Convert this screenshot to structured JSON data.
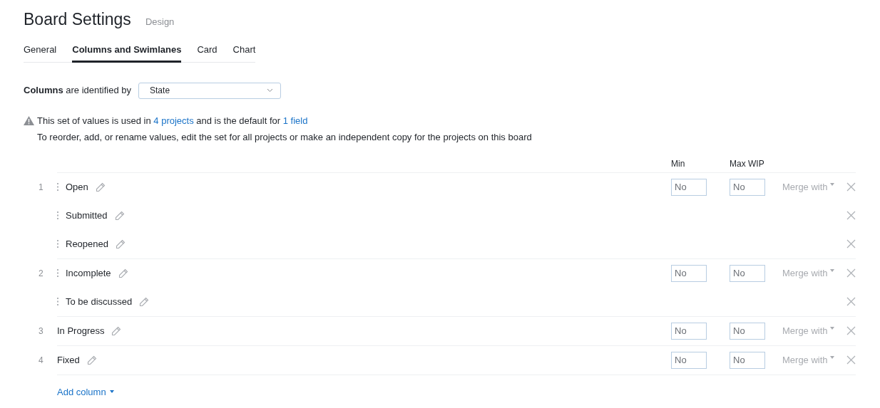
{
  "page": {
    "title": "Board Settings",
    "subtitle": "Design"
  },
  "tabs": [
    {
      "label": "General",
      "selected": false
    },
    {
      "label": "Columns and Swimlanes",
      "selected": true
    },
    {
      "label": "Card",
      "selected": false
    },
    {
      "label": "Chart",
      "selected": false
    }
  ],
  "identified_by": {
    "label": "**Columns** are identified by",
    "value": "State"
  },
  "notice": {
    "line_1": [
      "This set of values is used in ",
      "4 projects",
      " and is the default for ",
      "1 field"
    ],
    "line_2": "To reorder, add, or rename values, edit the set for all projects or make an independent copy for the projects on this board"
  },
  "table": {
    "headers": {
      "min": "Min",
      "max_wip": "Max WIP"
    },
    "columns": [
      {
        "number": "1",
        "min": "No",
        "max_wip": "No",
        "merge": "Merge with",
        "values": [
          {
            "name": "Open"
          },
          {
            "name": "Submitted"
          },
          {
            "name": "Reopened"
          }
        ]
      },
      {
        "number": "2",
        "min": "No",
        "max_wip": "No",
        "merge": "Merge with",
        "values": [
          {
            "name": "Incomplete"
          },
          {
            "name": "To be discussed"
          }
        ]
      },
      {
        "number": "3",
        "min": "No",
        "max_wip": "No",
        "merge": "Merge with",
        "values": [
          {
            "name": "In Progress"
          }
        ]
      },
      {
        "number": "4",
        "min": "No",
        "max_wip": "No",
        "merge": "Merge with",
        "values": [
          {
            "name": "Fixed"
          }
        ]
      }
    ]
  },
  "add_column": "Add column"
}
